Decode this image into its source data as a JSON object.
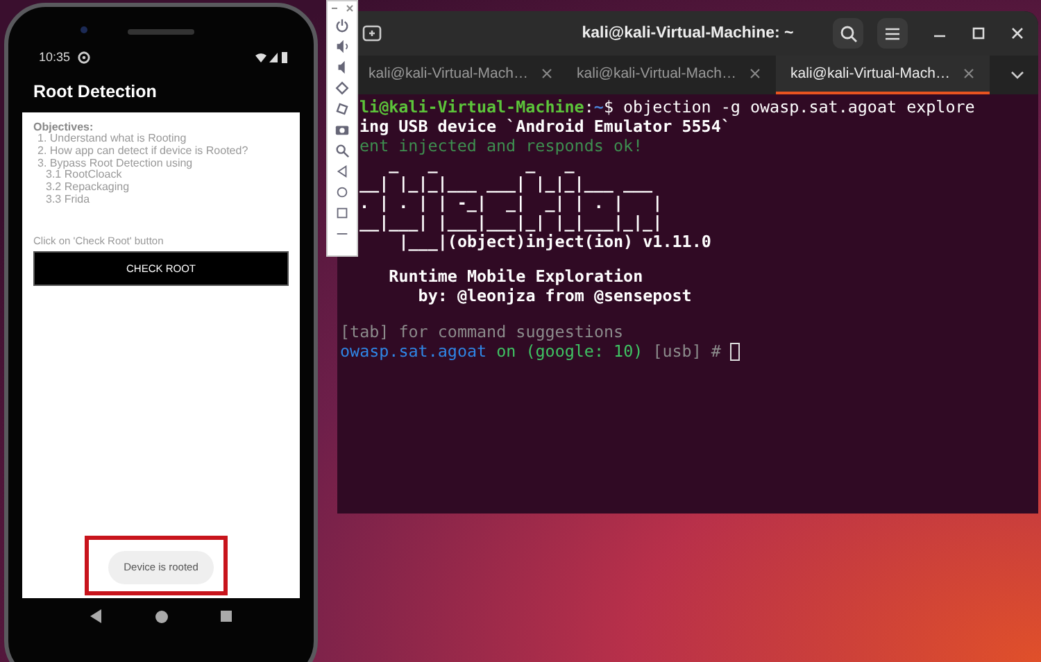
{
  "phone": {
    "status_bar": {
      "time": "10:35"
    },
    "app_bar": {
      "title": "Root Detection"
    },
    "objectives": {
      "heading": "Objectives:",
      "items": [
        {
          "text": "1. Understand what is Rooting"
        },
        {
          "text": "2. How app can detect if device is Rooted?"
        },
        {
          "text": "3. Bypass Root Detection using",
          "children": [
            {
              "text": "3.1 RootCloack"
            },
            {
              "text": "3.2 Repackaging"
            },
            {
              "text": "3.3 Frida"
            }
          ]
        }
      ]
    },
    "instruction": "Click on 'Check Root' button",
    "button": "CHECK ROOT",
    "toast": "Device is rooted"
  },
  "terminal": {
    "title": "kali@kali-Virtual-Machine: ~",
    "tabs": [
      {
        "label": "kali@kali-Virtual-Mach…",
        "selected": false
      },
      {
        "label": "kali@kali-Virtual-Mach…",
        "selected": false
      },
      {
        "label": "kali@kali-Virtual-Mach…",
        "selected": true
      }
    ],
    "blocks": [
      [
        {
          "segments": [
            {
              "text": "li@kali-Virtual-Machine",
              "kind": "user"
            },
            {
              "text": ":",
              "kind": "plain"
            },
            {
              "text": "~",
              "kind": "path"
            },
            {
              "text": "$ objection -g owasp.sat.agoat explore",
              "kind": "plain"
            }
          ]
        },
        {
          "segments": [
            {
              "text": "ing USB device `Android Emulator 5554`",
              "kind": "bold"
            }
          ]
        },
        {
          "segments": [
            {
              "text": "ent injected and responds ok!",
              "kind": "agent"
            }
          ]
        },
        {
          "segments": [
            {
              "text": "   _   _         _   _",
              "kind": "bold"
            }
          ]
        },
        {
          "segments": [
            {
              "text": "__| |_|_|___ ___| |_|_|___ ___",
              "kind": "bold"
            }
          ]
        },
        {
          "segments": [
            {
              "text": ". | . | | -_|  _|  _| | . |   |",
              "kind": "bold"
            }
          ]
        },
        {
          "segments": [
            {
              "text": "__|___| |___|___|_| |_|___|_|_|",
              "kind": "bold"
            }
          ]
        },
        {
          "segments": [
            {
              "text": "      |___|(object)inject(ion) v1.11.0",
              "kind": "bold"
            }
          ]
        }
      ],
      [
        {
          "segments": [
            {
              "text": "     Runtime Mobile Exploration",
              "kind": "bold"
            }
          ]
        },
        {
          "segments": [
            {
              "text": "        by: @leonjza from @sensepost",
              "kind": "bold"
            }
          ]
        }
      ],
      [
        {
          "segments": [
            {
              "text": "[tab] for command suggestions",
              "kind": "muted"
            }
          ]
        },
        {
          "segments": [
            {
              "text": "owasp.sat.agoat",
              "kind": "app"
            },
            {
              "text": " on (google: 10) ",
              "kind": "status"
            },
            {
              "text": "[usb] # ",
              "kind": "muted"
            }
          ],
          "cursor": true
        }
      ]
    ]
  }
}
